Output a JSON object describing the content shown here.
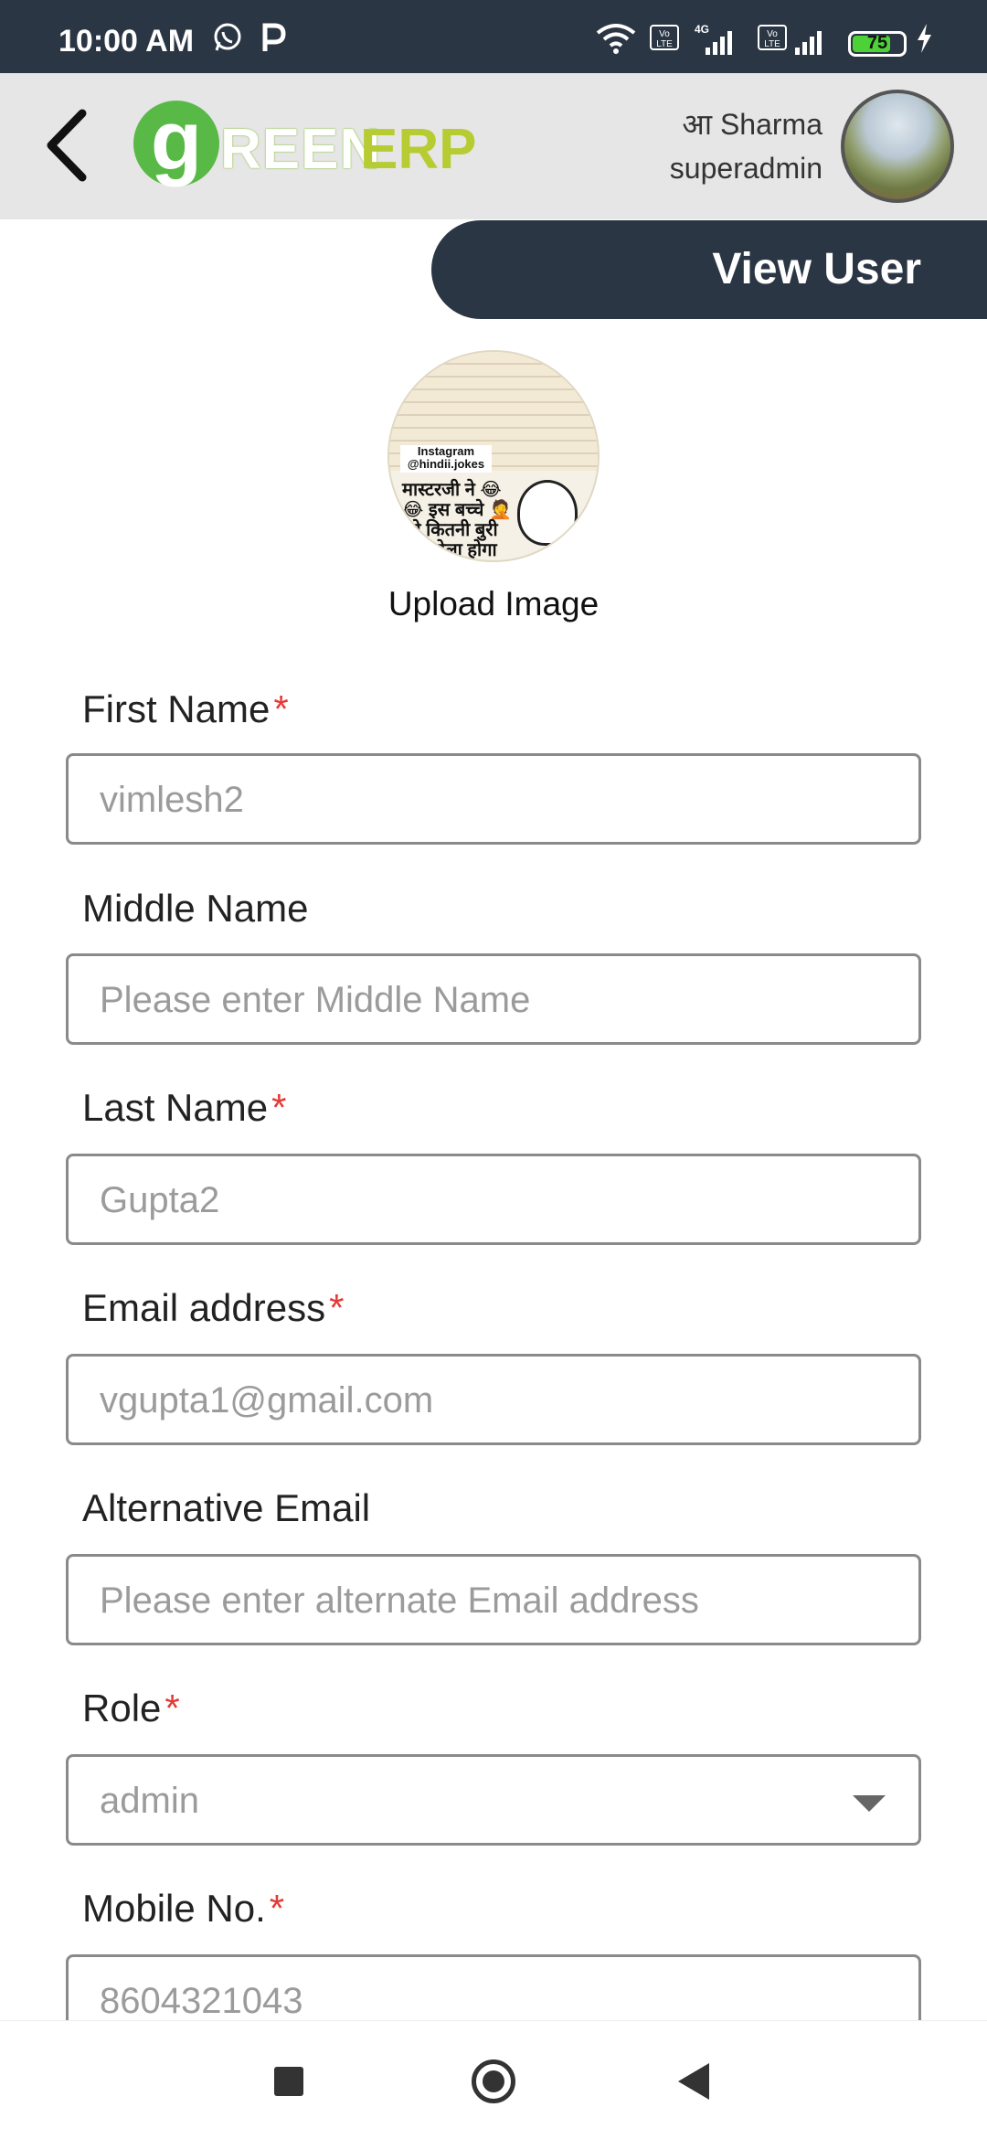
{
  "status_bar": {
    "time": "10:00 AM",
    "battery": "75",
    "icons": [
      "whatsapp-icon",
      "p-icon",
      "wifi-icon",
      "volte-icon",
      "4g-signal-icon",
      "volte-icon",
      "signal-icon",
      "battery-icon",
      "charging-icon"
    ]
  },
  "header": {
    "logo_g": "g",
    "logo_reen": "REEN",
    "logo_erp": "ERP",
    "user_name": "आ Sharma",
    "user_role": "superadmin"
  },
  "banner": {
    "title": "View User"
  },
  "profile": {
    "upload_label": "Upload Image",
    "image_tag": "Instagram @hindii.jokes",
    "image_text": "मास्टरजी ने 😂😂 इस बच्चे 🤦 को कितनी बुरी तरह पेला होगा"
  },
  "form": {
    "first_name": {
      "label": "First Name",
      "required": "*",
      "value": "vimlesh2"
    },
    "middle_name": {
      "label": "Middle Name",
      "placeholder": "Please enter Middle Name"
    },
    "last_name": {
      "label": "Last Name",
      "required": "*",
      "value": "Gupta2"
    },
    "email": {
      "label": "Email address",
      "required": "*",
      "value": "vgupta1@gmail.com"
    },
    "alt_email": {
      "label": "Alternative Email",
      "placeholder": "Please enter alternate Email address"
    },
    "role": {
      "label": "Role",
      "required": "*",
      "value": "admin"
    },
    "mobile": {
      "label": "Mobile No.",
      "required": "*",
      "value": "8604321043"
    }
  },
  "colors": {
    "dark": "#2b3645",
    "accent_green": "#59b947",
    "required": "#e53935"
  }
}
